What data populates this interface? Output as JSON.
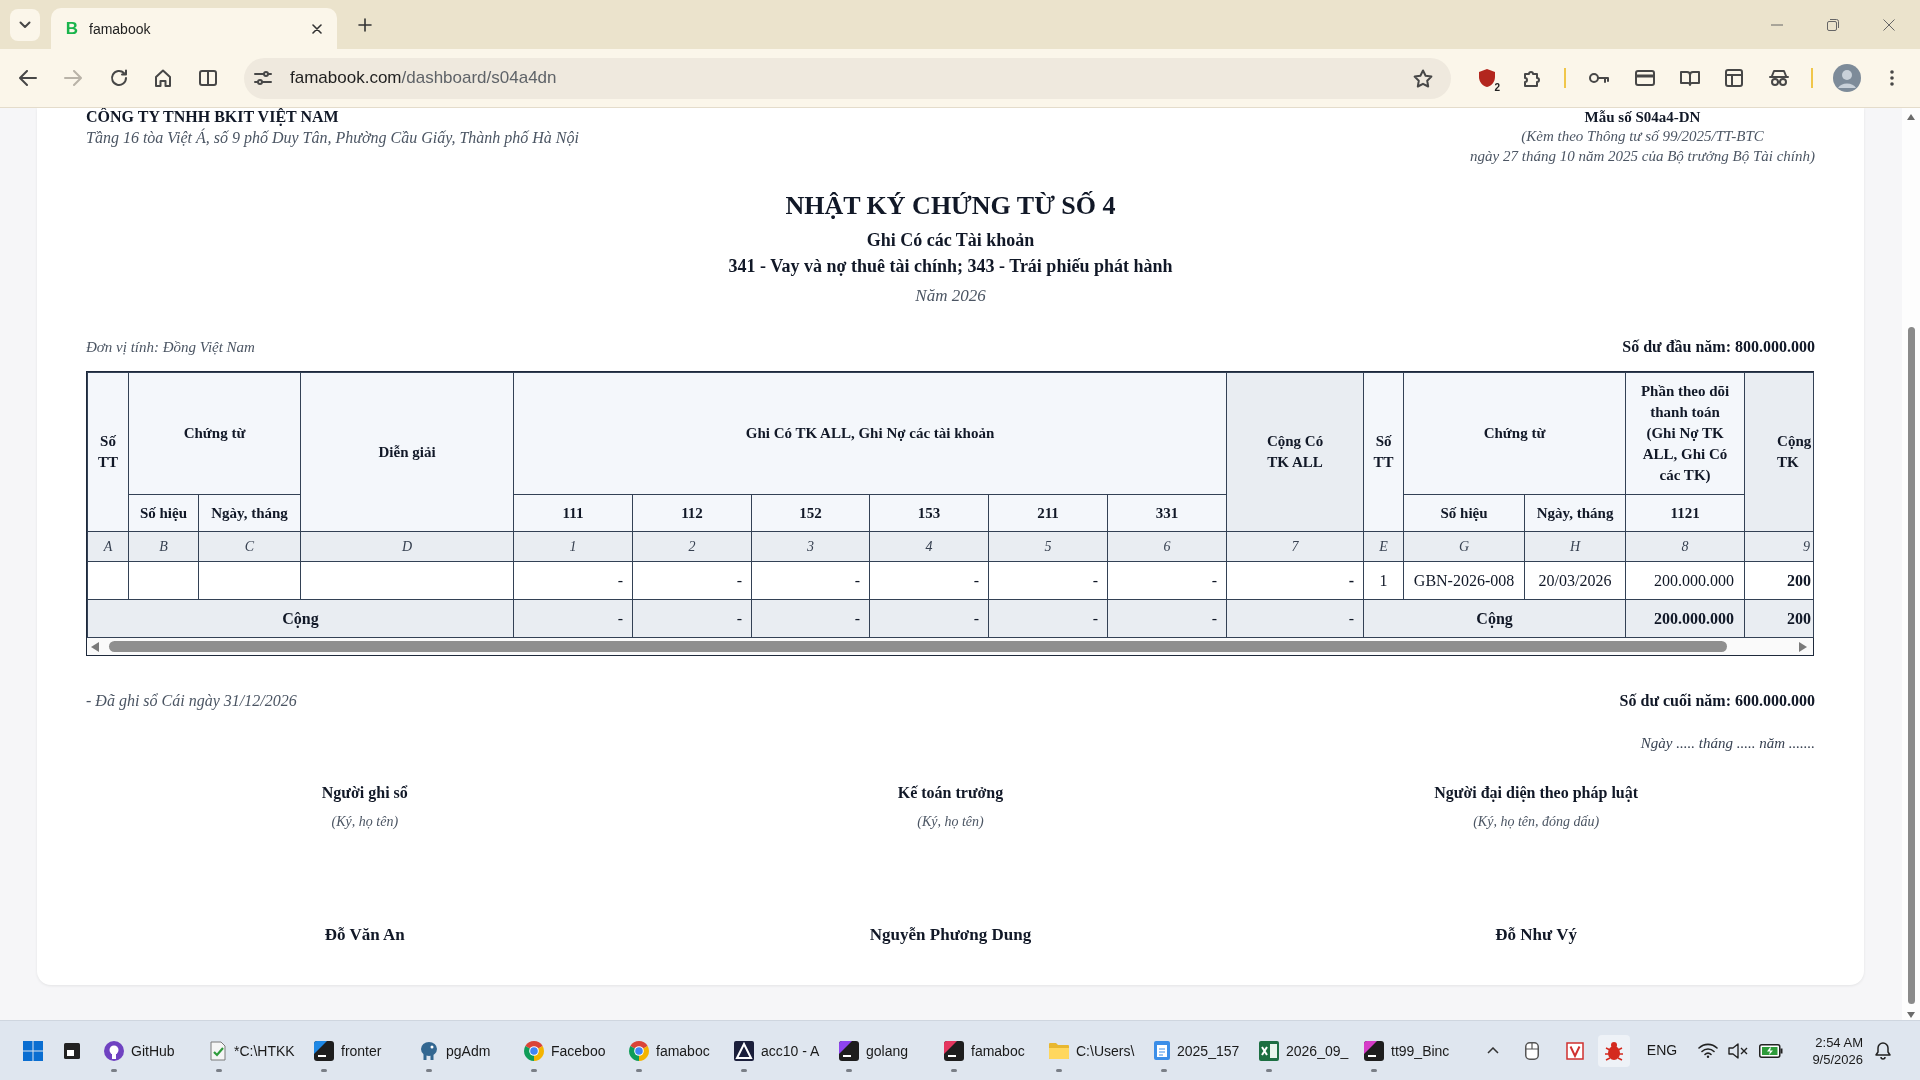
{
  "browser": {
    "tabs": [
      {
        "favicon": "B",
        "title": "famabook",
        "selected": true
      }
    ],
    "navigation": {
      "back_disabled": false,
      "forward_disabled": true
    },
    "address": {
      "host": "famabook.com",
      "path": "/dashboard/s04a4dn"
    },
    "extension_badge": "2"
  },
  "document": {
    "company_name": "CÔNG TY TNHH BKIT VIỆT NAM",
    "company_address": "Tầng 16 tòa Việt Á, số 9 phố Duy Tân, Phường Cầu Giấy, Thành phố Hà Nội",
    "form_code": "Mẫu số S04a4-DN",
    "form_notes": [
      "(Kèm theo Thông tư số 99/2025/TT-BTC",
      "ngày 27 tháng 10 năm 2025 của Bộ trưởng Bộ Tài chính)"
    ],
    "title": "NHẬT KÝ CHỨNG TỪ SỐ 4",
    "subtitle": "Ghi Có các Tài khoản",
    "accounts": "341 - Vay và nợ thuê tài chính; 343 - Trái phiếu phát hành",
    "year": "Năm 2026",
    "unit": "Đơn vị tính: Đồng Việt Nam",
    "opening_balance": "Số dư đầu năm: 800.000.000",
    "table": {
      "header_rows": [
        [
          {
            "label": "Số TT",
            "kind": "plain",
            "rowspan": 2
          },
          {
            "label": "Chứng từ",
            "kind": "plain",
            "colspan": 2
          },
          {
            "label": "Diễn giải",
            "kind": "plain",
            "rowspan": 2
          },
          {
            "label": "Ghi Có TK ALL, Ghi Nợ các tài khoản",
            "kind": "plain",
            "colspan": 6
          },
          {
            "label": "Cộng Có TK ALL",
            "kind": "total",
            "rowspan": 2
          },
          {
            "label": "Số TT",
            "kind": "plain",
            "rowspan": 2
          },
          {
            "label": "Chứng từ",
            "kind": "plain",
            "colspan": 2
          },
          {
            "label": "Phần theo dõi thanh toán (Ghi Nợ TK ALL, Ghi Có các TK)",
            "kind": "plain"
          },
          {
            "label": "Cộng TK",
            "kind": "total",
            "rowspan": 2
          }
        ],
        [
          {
            "label": "Số hiệu",
            "kind": "plain"
          },
          {
            "label": "Ngày, tháng",
            "kind": "plain"
          },
          {
            "label": "111",
            "kind": "plain"
          },
          {
            "label": "112",
            "kind": "plain"
          },
          {
            "label": "152",
            "kind": "plain"
          },
          {
            "label": "153",
            "kind": "plain"
          },
          {
            "label": "211",
            "kind": "plain"
          },
          {
            "label": "331",
            "kind": "plain"
          },
          {
            "label": "Số hiệu",
            "kind": "plain"
          },
          {
            "label": "Ngày, tháng",
            "kind": "plain"
          },
          {
            "label": "1121",
            "kind": "plain"
          }
        ]
      ],
      "code_row": [
        "A",
        "B",
        "C",
        "D",
        "1",
        "2",
        "3",
        "4",
        "5",
        "6",
        "7",
        "E",
        "G",
        "H",
        "8",
        "9"
      ],
      "rows": [
        {
          "cells": [
            null,
            null,
            null,
            null,
            "-",
            "-",
            "-",
            "-",
            "-",
            "-",
            "-",
            "1",
            "GBN-2026-008",
            "20/03/2026",
            "200.000.000",
            "200"
          ]
        }
      ],
      "total_row": [
        {
          "kind": "label",
          "text": "Cộng",
          "colspan": 4
        },
        {
          "kind": "value",
          "text": "-"
        },
        {
          "kind": "value",
          "text": "-"
        },
        {
          "kind": "value",
          "text": "-"
        },
        {
          "kind": "value",
          "text": "-"
        },
        {
          "kind": "value",
          "text": "-"
        },
        {
          "kind": "value",
          "text": "-"
        },
        {
          "kind": "value",
          "text": "-"
        },
        {
          "kind": "label",
          "text": "Cộng",
          "colspan": 3
        },
        {
          "kind": "value",
          "text": "200.000.000"
        },
        {
          "kind": "value",
          "text": "200"
        }
      ]
    },
    "posted_note": "- Đã ghi sổ Cái ngày 31/12/2026",
    "closing_balance": "Số dư cuối năm: 600.000.000",
    "date_line": "Ngày ..... tháng ..... năm .......",
    "signatures": [
      {
        "role": "Người ghi sổ",
        "note": "(Ký, họ tên)",
        "name": "Đỗ Văn An"
      },
      {
        "role": "Kế toán trưởng",
        "note": "(Ký, họ tên)",
        "name": "Nguyễn Phương Dung"
      },
      {
        "role": "Người đại diện theo pháp luật",
        "note": "(Ký, họ tên, đóng dấu)",
        "name": "Đỗ Như Vý"
      }
    ]
  },
  "taskbar": {
    "apps": [
      {
        "label": "GitHub",
        "running": true
      },
      {
        "label": "*C:\\HTKK",
        "running": true
      },
      {
        "label": "fronter",
        "running": true
      },
      {
        "label": "pgAdm",
        "running": true
      },
      {
        "label": "Faceboo",
        "running": true
      },
      {
        "label": "famaboc",
        "running": true
      },
      {
        "label": "acc10 - A",
        "running": true
      },
      {
        "label": "golang",
        "running": true
      },
      {
        "label": "famaboc",
        "running": true
      },
      {
        "label": "C:\\Users\\",
        "running": true
      },
      {
        "label": "2025_157",
        "running": true
      },
      {
        "label": "2026_09_",
        "running": true
      },
      {
        "label": "tt99_Binc",
        "running": true
      }
    ],
    "tray": {
      "language": "ENG",
      "time": "2:54 AM",
      "date": "9/5/2026"
    }
  }
}
